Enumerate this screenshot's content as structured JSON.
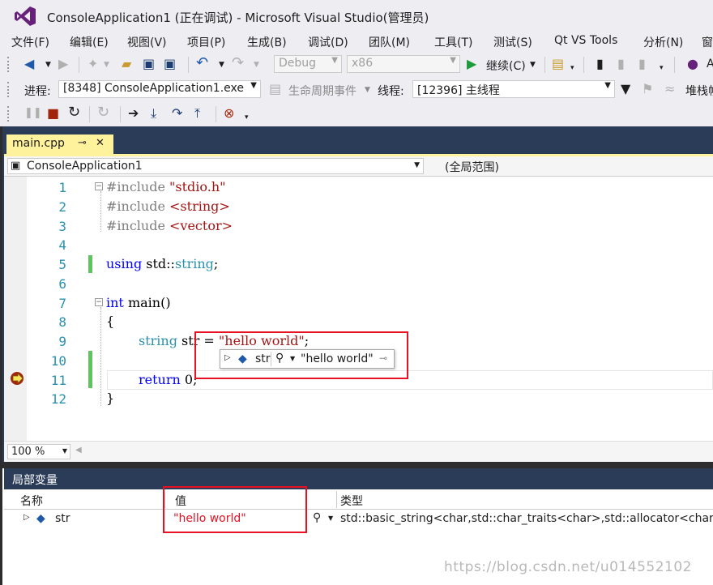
{
  "window": {
    "title": "ConsoleApplication1 (正在调试) - Microsoft Visual Studio(管理员)"
  },
  "menu": [
    "文件(F)",
    "编辑(E)",
    "视图(V)",
    "项目(P)",
    "生成(B)",
    "调试(D)",
    "团队(M)",
    "工具(T)",
    "测试(S)",
    "Qt VS Tools",
    "分析(N)",
    "窗"
  ],
  "toolbar1": {
    "config": "Debug",
    "platform": "x86",
    "continue_label": "继续(C)",
    "truncated": "A"
  },
  "toolbar2": {
    "process_label": "进程:",
    "process_value": "[8348] ConsoleApplication1.exe",
    "lifecycle_label": "生命周期事件",
    "thread_label": "线程:",
    "thread_value": "[12396] 主线程",
    "stack_label": "堆栈帧"
  },
  "tab": {
    "filename": "main.cpp",
    "pin": "⊸",
    "close": "✕"
  },
  "navbar": {
    "project": "ConsoleApplication1",
    "scope": "(全局范围)"
  },
  "code": {
    "line_numbers": [
      "1",
      "2",
      "3",
      "4",
      "5",
      "6",
      "7",
      "8",
      "9",
      "10",
      "11",
      "12"
    ],
    "l1_pp": "#include ",
    "l1_str": "\"stdio.h\"",
    "l2_pp": "#include ",
    "l2_str": "<string>",
    "l3_pp": "#include ",
    "l3_str": "<vector>",
    "l5_kw": "using",
    "l5_rest": " std::",
    "l5_ty": "string",
    "l5_end": ";",
    "l7_kw": "int",
    "l7_rest": " main()",
    "l8": "{",
    "l9_ty": "string",
    "l9_rest": " str = ",
    "l9_str": "\"hello world\"",
    "l9_end": ";",
    "l11_kw": "return",
    "l11_rest": " 0;",
    "l12": "}"
  },
  "datatip": {
    "name": "str",
    "value": "\"hello world\""
  },
  "zoom": "100 %",
  "locals": {
    "title": "局部变量",
    "col_name": "名称",
    "col_value": "值",
    "col_type": "类型",
    "rows": [
      {
        "name": "str",
        "value": "\"hello world\"",
        "type": "std::basic_string<char,std::char_traits<char>,std::allocator<char> >"
      }
    ]
  },
  "watermark": "https://blog.csdn.net/u014552102",
  "colors": {
    "accent": "#68217a",
    "doc_bg": "#2b3c59",
    "tab": "#fff29d",
    "highlight": "#e81123",
    "change_bar": "#5ec45e"
  }
}
